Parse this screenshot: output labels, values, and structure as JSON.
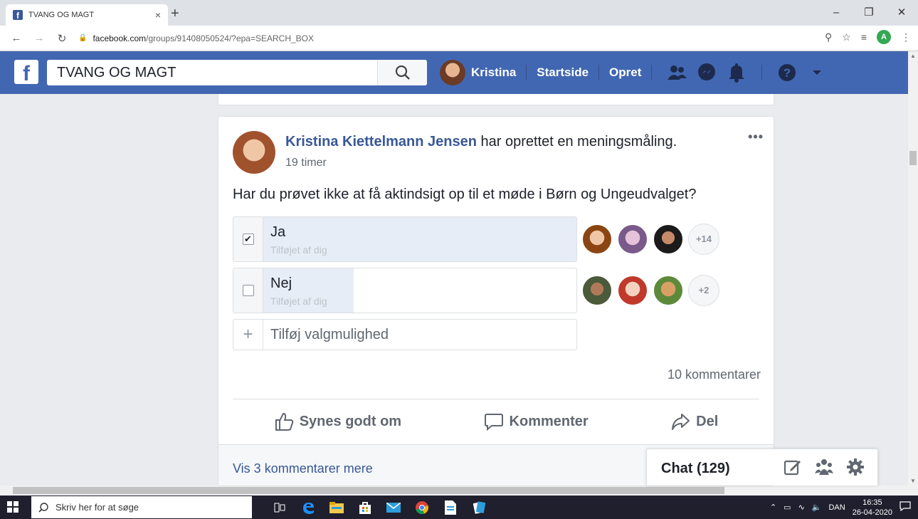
{
  "browser": {
    "tab_title": "TVANG OG MAGT",
    "tab_close": "×",
    "new_tab": "+",
    "url_host": "facebook.com",
    "url_path": "/groups/91408050524/?epa=SEARCH_BOX",
    "profile_initial": "A"
  },
  "fb": {
    "logo": "f",
    "search_value": "TVANG OG MAGT",
    "user_name": "Kristina",
    "nav_home": "Startside",
    "nav_create": "Opret"
  },
  "post": {
    "author": "Kristina Kiettelmann Jensen",
    "action_text": " har oprettet en meningsmåling.",
    "time": "19 timer",
    "question": "Har du prøvet ikke at få aktindsigt op til et møde i Børn og Ungeudvalget?",
    "options": [
      {
        "label": "Ja",
        "sub": "Tilføjet af dig",
        "checked": true,
        "fill_fraction": 1.0,
        "more": "+14"
      },
      {
        "label": "Nej",
        "sub": "Tilføjet af dig",
        "checked": false,
        "fill_fraction": 0.35,
        "more": "+2"
      }
    ],
    "add_option_placeholder": "Tilføj valgmulighed",
    "comments_count": "10 kommentarer",
    "like_label": "Synes godt om",
    "comment_label": "Kommenter",
    "share_label": "Del",
    "more_comments": "Vis 3 kommentarer mere"
  },
  "chat": {
    "label": "Chat (129)"
  },
  "taskbar": {
    "search_placeholder": "Skriv her for at søge",
    "language": "DAN",
    "time": "16:35",
    "date": "26-04-2020"
  },
  "colors": {
    "fb_blue": "#4267b2",
    "link_blue": "#385898"
  }
}
